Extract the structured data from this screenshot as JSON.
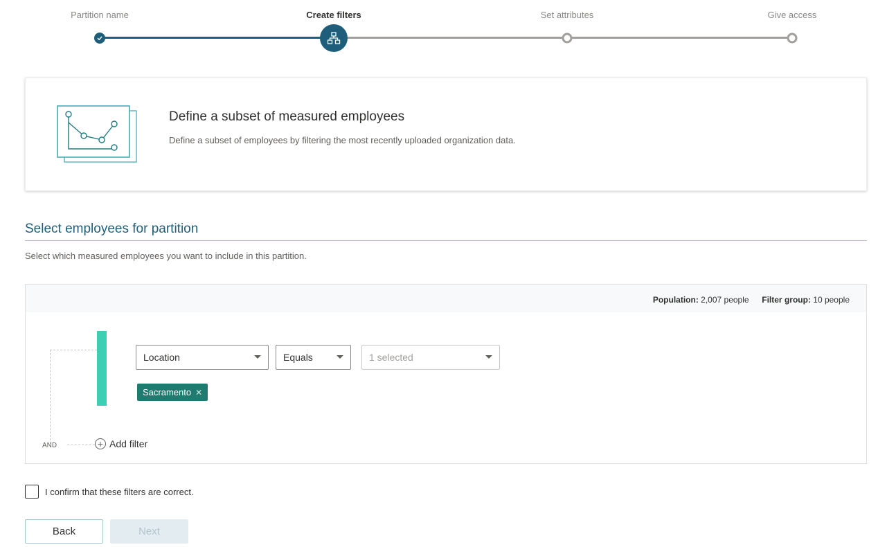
{
  "stepper": {
    "steps": [
      {
        "label": "Partition name",
        "state": "done"
      },
      {
        "label": "Create filters",
        "state": "current"
      },
      {
        "label": "Set attributes",
        "state": "todo"
      },
      {
        "label": "Give access",
        "state": "todo"
      }
    ],
    "current_icon": "org-hierarchy-icon",
    "done_icon": "checkmark-icon"
  },
  "info_card": {
    "title": "Define a subset of measured employees",
    "description": "Define a subset of employees by filtering the most recently uploaded organization data.",
    "illustration_icon": "line-chart-illustration-icon"
  },
  "section": {
    "title": "Select employees for partition",
    "description": "Select which measured employees you want to include in this partition."
  },
  "filter_panel": {
    "population_label": "Population:",
    "population_value": "2,007 people",
    "filter_group_label": "Filter group:",
    "filter_group_value": "10 people",
    "filter": {
      "field": "Location",
      "operator": "Equals",
      "values_placeholder": "1 selected",
      "chips": [
        "Sacramento"
      ]
    },
    "logic_label": "AND",
    "add_filter_label": "Add filter"
  },
  "confirm": {
    "label": "I confirm that these filters are correct.",
    "checked": false
  },
  "buttons": {
    "back": "Back",
    "next": "Next"
  },
  "colors": {
    "accent": "#1f5e7a",
    "group_bar": "#3ccfb4",
    "chip": "#1f7a6f",
    "track_todo": "#a19f9d"
  }
}
